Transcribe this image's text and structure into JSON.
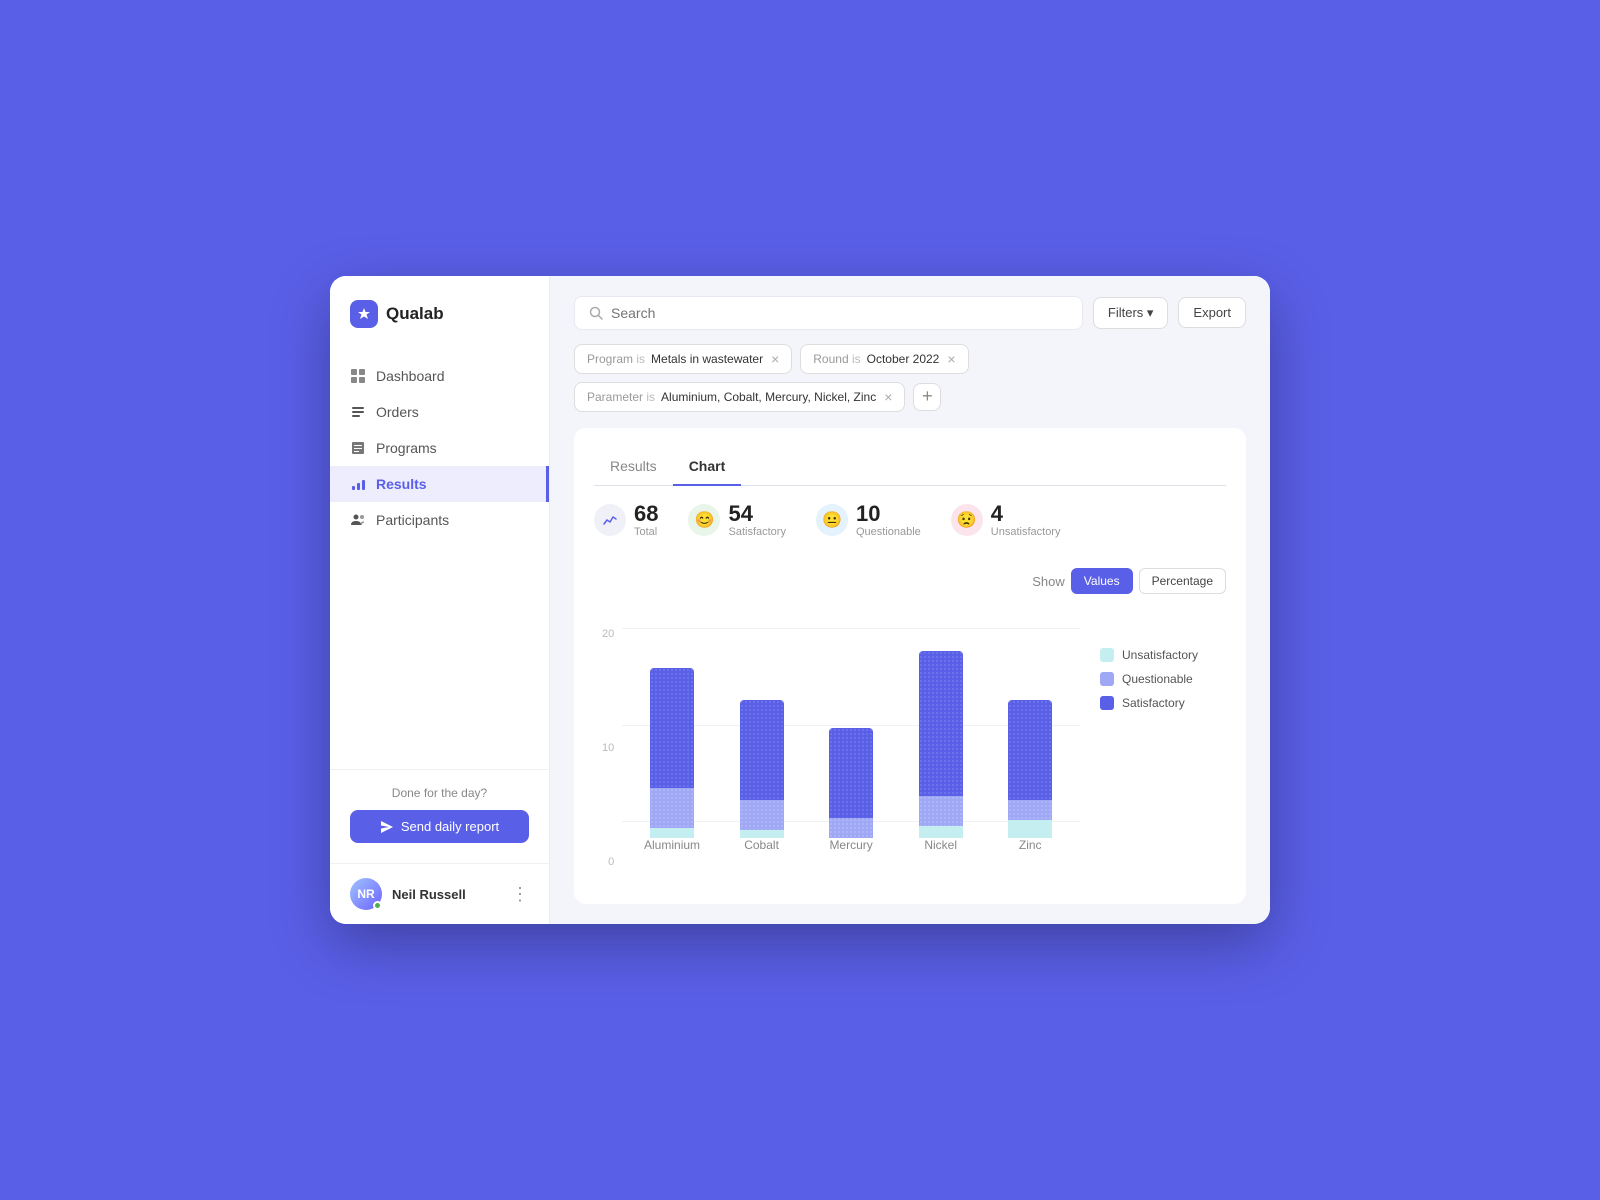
{
  "app": {
    "name": "Qualab"
  },
  "sidebar": {
    "nav_items": [
      {
        "id": "dashboard",
        "label": "Dashboard",
        "active": false
      },
      {
        "id": "orders",
        "label": "Orders",
        "active": false
      },
      {
        "id": "programs",
        "label": "Programs",
        "active": false
      },
      {
        "id": "results",
        "label": "Results",
        "active": true
      },
      {
        "id": "participants",
        "label": "Participants",
        "active": false
      }
    ],
    "done_label": "Done for the day?",
    "send_btn_label": "Send daily report"
  },
  "user": {
    "name": "Neil Russell",
    "initials": "NR"
  },
  "search": {
    "placeholder": "Search"
  },
  "filters_btn": "Filters",
  "export_btn": "Export",
  "chips": [
    {
      "key": "Program",
      "op": "is",
      "value": "Metals in wastewater"
    },
    {
      "key": "Round",
      "op": "is",
      "value": "October 2022"
    },
    {
      "key": "Parameter",
      "op": "is",
      "value": "Aluminium, Cobalt, Mercury, Nickel, Zinc"
    }
  ],
  "tabs": [
    {
      "id": "results",
      "label": "Results",
      "active": false
    },
    {
      "id": "chart",
      "label": "Chart",
      "active": true
    }
  ],
  "stats": {
    "total": {
      "value": "68",
      "label": "Total"
    },
    "satisfactory": {
      "value": "54",
      "label": "Satisfactory"
    },
    "questionable": {
      "value": "10",
      "label": "Questionable"
    },
    "unsatisfactory": {
      "value": "4",
      "label": "Unsatisfactory"
    }
  },
  "show": {
    "label": "Show",
    "values_btn": "Values",
    "percentage_btn": "Percentage"
  },
  "chart": {
    "y_labels": [
      "20",
      "10",
      "0"
    ],
    "bars": [
      {
        "name": "Aluminium",
        "satisfactory_h": 120,
        "questionable_h": 40,
        "unsatisfactory_h": 10
      },
      {
        "name": "Cobalt",
        "satisfactory_h": 100,
        "questionable_h": 30,
        "unsatisfactory_h": 8
      },
      {
        "name": "Mercury",
        "satisfactory_h": 90,
        "questionable_h": 20,
        "unsatisfactory_h": 0
      },
      {
        "name": "Nickel",
        "satisfactory_h": 145,
        "questionable_h": 30,
        "unsatisfactory_h": 12
      },
      {
        "name": "Zinc",
        "satisfactory_h": 100,
        "questionable_h": 20,
        "unsatisfactory_h": 18
      }
    ],
    "legend": [
      {
        "id": "unsatisfactory",
        "label": "Unsatisfactory"
      },
      {
        "id": "questionable",
        "label": "Questionable"
      },
      {
        "id": "satisfactory",
        "label": "Satisfactory"
      }
    ]
  }
}
